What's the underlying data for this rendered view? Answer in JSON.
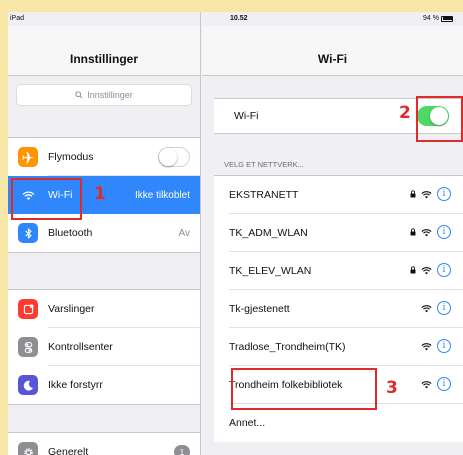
{
  "status_bar": {
    "device": "iPad",
    "time": "10.52",
    "battery": "94 %"
  },
  "left_pane": {
    "title": "Innstillinger",
    "search_placeholder": "Innstillinger",
    "groups": [
      [
        {
          "label": "Flymodus",
          "icon": "airplane-icon",
          "color": "#ff9500",
          "toggle": "off"
        },
        {
          "label": "Wi-Fi",
          "icon": "wifi-icon",
          "color": "#2f87fb",
          "value": "Ikke tilkoblet",
          "selected": true
        },
        {
          "label": "Bluetooth",
          "icon": "bluetooth-icon",
          "color": "#2f87fb",
          "value": "Av"
        }
      ],
      [
        {
          "label": "Varslinger",
          "icon": "notifications-icon",
          "color": "#ff3b30"
        },
        {
          "label": "Kontrollsenter",
          "icon": "control-center-icon",
          "color": "#8e8e93"
        },
        {
          "label": "Ikke forstyrr",
          "icon": "moon-icon",
          "color": "#5856d6"
        }
      ],
      [
        {
          "label": "Generelt",
          "icon": "gear-icon",
          "color": "#8e8e93",
          "badge": "1"
        }
      ]
    ]
  },
  "right_pane": {
    "title": "Wi-Fi",
    "wifi_toggle_label": "Wi-Fi",
    "wifi_enabled": true,
    "section_label": "VELG ET NETTVERK...",
    "networks": [
      {
        "name": "EKSTRANETT",
        "locked": true
      },
      {
        "name": "TK_ADM_WLAN",
        "locked": true
      },
      {
        "name": "TK_ELEV_WLAN",
        "locked": true
      },
      {
        "name": "Tk-gjestenett",
        "locked": false
      },
      {
        "name": "Tradlose_Trondheim(TK)",
        "locked": false
      },
      {
        "name": "Trondheim folkebibliotek",
        "locked": false
      }
    ],
    "other_label": "Annet..."
  },
  "annotations": [
    "1",
    "2",
    "3"
  ],
  "colors": {
    "accent": "#2f87fb",
    "toggle_on": "#4cd964",
    "annotation": "#e02b2b",
    "page_bg": "#f6e7a6"
  }
}
